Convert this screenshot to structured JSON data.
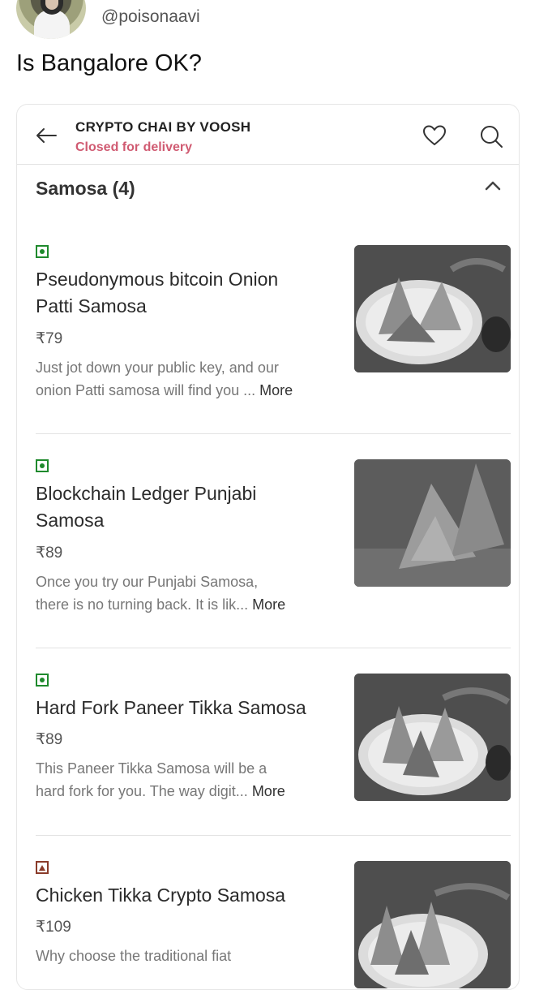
{
  "tweet": {
    "handle": "@poisonaavi",
    "text": "Is Bangalore OK?"
  },
  "restaurant": {
    "name": "CRYPTO CHAI BY VOOSH",
    "status": "Closed for delivery",
    "status_color": "#d05b72"
  },
  "section": {
    "title": "Samosa (4)"
  },
  "items": [
    {
      "diet": "veg",
      "name_line1": "Pseudonymous bitcoin Onion",
      "name_line2": "Patti Samosa",
      "price": "₹79",
      "desc_line1": "Just jot down your public key, and our",
      "desc_line2": "onion Patti samosa will find you ...",
      "more": "More"
    },
    {
      "diet": "veg",
      "name_line1": "Blockchain Ledger Punjabi",
      "name_line2": "Samosa",
      "price": "₹89",
      "desc_line1": "Once you try our Punjabi Samosa,",
      "desc_line2": "there is no turning back. It is lik...",
      "more": "More"
    },
    {
      "diet": "veg",
      "name_line1": "Hard Fork Paneer Tikka Samosa",
      "price": "₹89",
      "desc_line1": "This Paneer Tikka Samosa will be a",
      "desc_line2": "hard fork for you. The way digit...",
      "more": "More"
    },
    {
      "diet": "non-veg",
      "name_line1": "Chicken Tikka Crypto Samosa",
      "price": "₹109",
      "desc_line1": "Why choose the traditional fiat"
    }
  ],
  "icons": {
    "back": "arrow-left-icon",
    "favorite": "heart-icon",
    "search": "search-icon",
    "collapse": "chevron-up-icon",
    "veg": "veg-indicator-icon",
    "nonveg": "non-veg-indicator-icon"
  },
  "colors": {
    "veg": "#1f8a2d",
    "nonveg": "#8a3b2a"
  }
}
